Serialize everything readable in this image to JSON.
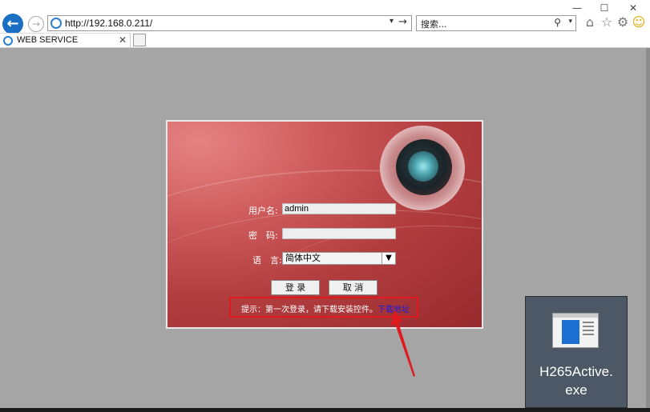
{
  "browser": {
    "address_url": "http://192.168.0.211/",
    "search_placeholder": "搜索...",
    "tab_title": "WEB SERVICE",
    "window_buttons": [
      "—",
      "☐",
      "✕"
    ]
  },
  "login": {
    "username_label": "用户名:",
    "username_value": "admin",
    "password_label": "密　码:",
    "password_value": "",
    "language_label": "语　言:",
    "language_value": "简体中文",
    "login_button": "登 录",
    "cancel_button": "取 消",
    "hint_text": "提示：第一次登录，请下载安装控件。",
    "download_link": "下载地址"
  },
  "desktop_file": {
    "name_line1": "H265Active.",
    "name_line2": "exe"
  },
  "colors": {
    "highlight": "#e0191e",
    "panel": "#b23d3f",
    "link": "#1b1bd8"
  }
}
